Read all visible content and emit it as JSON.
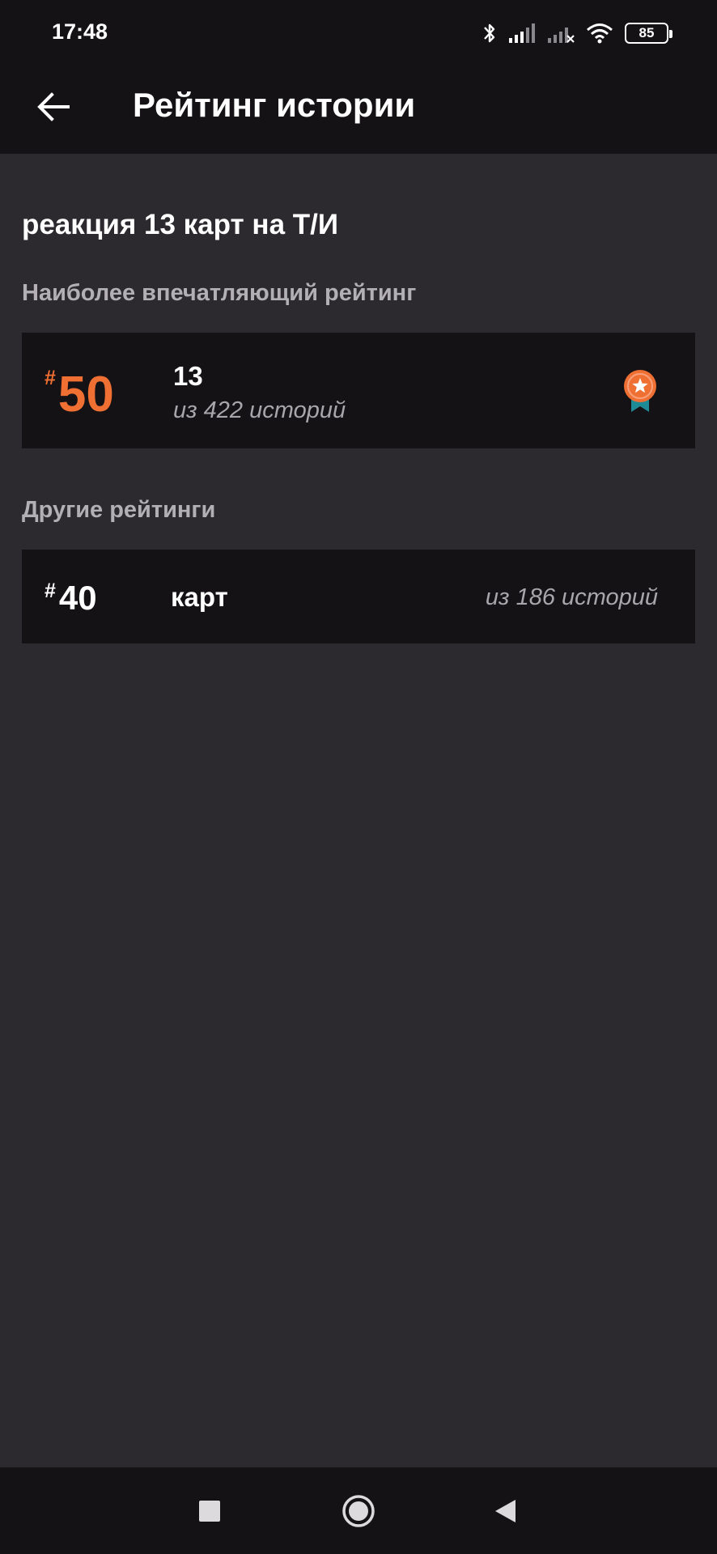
{
  "status_bar": {
    "time": "17:48",
    "battery": "85",
    "icons": [
      "bluetooth-icon",
      "signal-icon",
      "signal-no-service-icon",
      "wifi-icon",
      "battery-icon"
    ]
  },
  "app_bar": {
    "title": "Рейтинг истории",
    "back_icon": "arrow-left-icon"
  },
  "story": {
    "title": "реакция 13 карт на Т/И"
  },
  "best_rating": {
    "section_label": "Наиболее впечатляющий рейтинг",
    "hash": "#",
    "rank": "50",
    "tag": "13",
    "count": "из 422 историй",
    "icon": "medal-icon",
    "accent": "#f07034"
  },
  "other_ratings": {
    "section_label": "Другие рейтинги",
    "items": [
      {
        "hash": "#",
        "rank": "40",
        "tag": "карт",
        "count": "из 186 историй"
      }
    ]
  },
  "nav_bar": {
    "icons": [
      "recent-apps-icon",
      "home-icon",
      "back-icon"
    ]
  },
  "colors": {
    "background": "#2c2a2e",
    "surface": "#141215",
    "accent": "#f07034",
    "muted_text": "#a9a6ab"
  }
}
